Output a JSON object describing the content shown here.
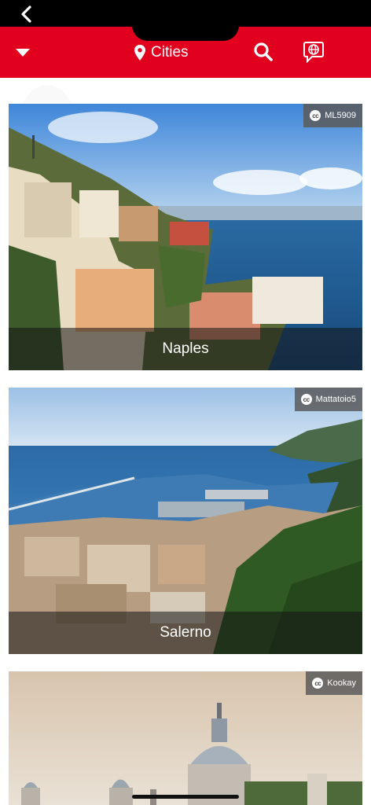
{
  "header": {
    "title": "Cities",
    "accent_color": "#e1001e"
  },
  "icons": {
    "back": "chevron-left-icon",
    "dropdown": "caret-down-icon",
    "location": "map-pin-icon",
    "search": "search-icon",
    "language": "globe-chat-icon",
    "license": "creative-commons-icon"
  },
  "cities": [
    {
      "name": "Naples",
      "credit": "ML5909"
    },
    {
      "name": "Salerno",
      "credit": "Mattatoio5"
    },
    {
      "name": "",
      "credit": "Kookay"
    }
  ]
}
